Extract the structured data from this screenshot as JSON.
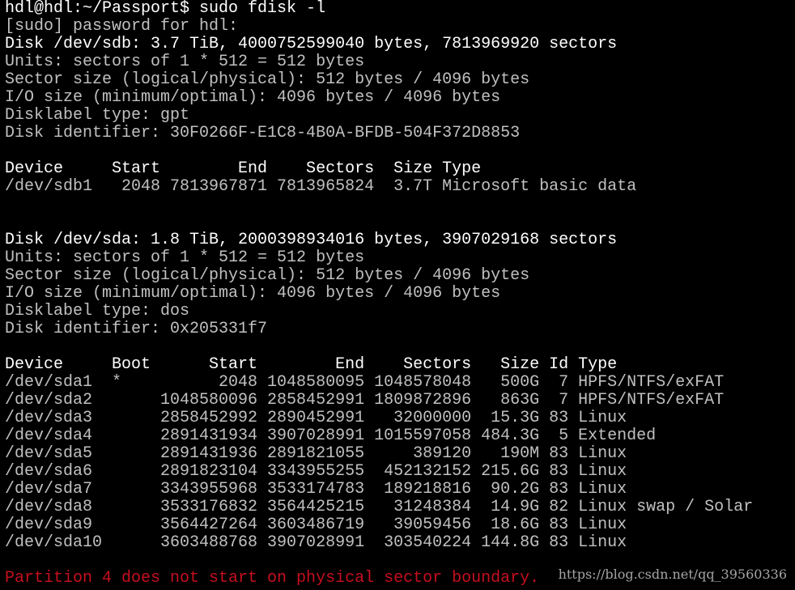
{
  "terminal": {
    "lines": [
      {
        "text": "hdl@hdl:~/Passport$ sudo fdisk -l",
        "style": "bright"
      },
      {
        "text": "[sudo] password for hdl:",
        "style": "normal"
      },
      {
        "text": "Disk /dev/sdb: 3.7 TiB, 4000752599040 bytes, 7813969920 sectors",
        "style": "bright"
      },
      {
        "text": "Units: sectors of 1 * 512 = 512 bytes",
        "style": "normal"
      },
      {
        "text": "Sector size (logical/physical): 512 bytes / 4096 bytes",
        "style": "normal"
      },
      {
        "text": "I/O size (minimum/optimal): 4096 bytes / 4096 bytes",
        "style": "normal"
      },
      {
        "text": "Disklabel type: gpt",
        "style": "normal"
      },
      {
        "text": "Disk identifier: 30F0266F-E1C8-4B0A-BFDB-504F372D8853",
        "style": "normal"
      },
      {
        "text": "",
        "style": "normal"
      },
      {
        "text": "Device     Start        End    Sectors  Size Type",
        "style": "bright"
      },
      {
        "text": "/dev/sdb1   2048 7813967871 7813965824  3.7T Microsoft basic data",
        "style": "normal"
      },
      {
        "text": "",
        "style": "normal"
      },
      {
        "text": "",
        "style": "normal"
      },
      {
        "text": "Disk /dev/sda: 1.8 TiB, 2000398934016 bytes, 3907029168 sectors",
        "style": "bright"
      },
      {
        "text": "Units: sectors of 1 * 512 = 512 bytes",
        "style": "normal"
      },
      {
        "text": "Sector size (logical/physical): 512 bytes / 4096 bytes",
        "style": "normal"
      },
      {
        "text": "I/O size (minimum/optimal): 4096 bytes / 4096 bytes",
        "style": "normal"
      },
      {
        "text": "Disklabel type: dos",
        "style": "normal"
      },
      {
        "text": "Disk identifier: 0x205331f7",
        "style": "normal"
      },
      {
        "text": "",
        "style": "normal"
      },
      {
        "text": "Device     Boot      Start        End    Sectors   Size Id Type",
        "style": "bright"
      },
      {
        "text": "/dev/sda1  *          2048 1048580095 1048578048   500G  7 HPFS/NTFS/exFAT",
        "style": "normal"
      },
      {
        "text": "/dev/sda2       1048580096 2858452991 1809872896   863G  7 HPFS/NTFS/exFAT",
        "style": "normal"
      },
      {
        "text": "/dev/sda3       2858452992 2890452991   32000000  15.3G 83 Linux",
        "style": "normal"
      },
      {
        "text": "/dev/sda4       2891431934 3907028991 1015597058 484.3G  5 Extended",
        "style": "normal"
      },
      {
        "text": "/dev/sda5       2891431936 2891821055     389120   190M 83 Linux",
        "style": "normal"
      },
      {
        "text": "/dev/sda6       2891823104 3343955255  452132152 215.6G 83 Linux",
        "style": "normal"
      },
      {
        "text": "/dev/sda7       3343955968 3533174783  189218816  90.2G 83 Linux",
        "style": "normal"
      },
      {
        "text": "/dev/sda8       3533176832 3564425215   31248384  14.9G 82 Linux swap / Solar",
        "style": "normal"
      },
      {
        "text": "/dev/sda9       3564427264 3603486719   39059456  18.6G 83 Linux",
        "style": "normal"
      },
      {
        "text": "/dev/sda10      3603488768 3907028991  303540224 144.8G 83 Linux",
        "style": "normal"
      },
      {
        "text": "",
        "style": "normal"
      },
      {
        "text": "Partition 4 does not start on physical sector boundary.",
        "style": "error"
      }
    ]
  },
  "watermark": "https://blog.csdn.net/qq_39560336",
  "colors": {
    "background": "#000000",
    "text": "#c0c0c0",
    "bright_text": "#ffffff",
    "error_text": "#c50f1f"
  }
}
